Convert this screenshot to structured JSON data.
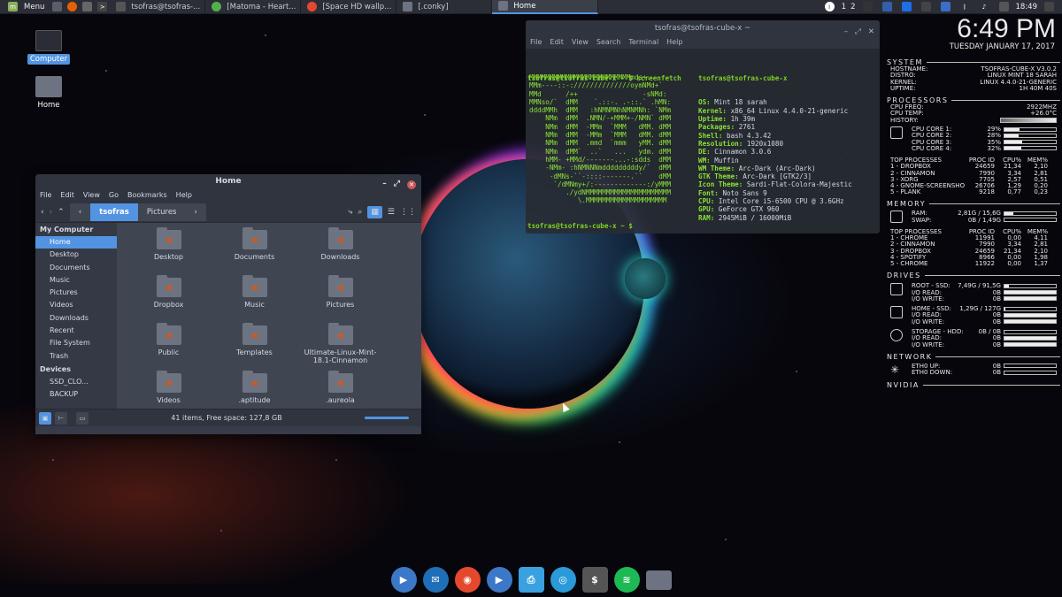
{
  "topbar": {
    "menu_label": "Menu",
    "tasks": [
      "tsofras@tsofras-...",
      "[Matoma - Heart...",
      "[Space HD wallp...",
      "[.conky]",
      "Home"
    ],
    "workspaces": [
      "1",
      "2"
    ],
    "clock": "18:49"
  },
  "desktop": {
    "icons": [
      "Computer",
      "Home"
    ]
  },
  "filemanager": {
    "title": "Home",
    "menu": [
      "File",
      "Edit",
      "View",
      "Go",
      "Bookmarks",
      "Help"
    ],
    "breadcrumb": [
      "tsofras",
      "Pictures"
    ],
    "sidebar": {
      "header_computer": "My Computer",
      "items": [
        "Home",
        "Desktop",
        "Documents",
        "Music",
        "Pictures",
        "Videos",
        "Downloads",
        "Recent",
        "File System",
        "Trash"
      ],
      "header_devices": "Devices",
      "devices": [
        "SSD_CLO...",
        "BACKUP"
      ]
    },
    "files": [
      "Desktop",
      "Documents",
      "Downloads",
      "Dropbox",
      "Music",
      "Pictures",
      "Public",
      "Templates",
      "Ultimate-Linux-Mint-18.1-Cinnamon",
      "Videos",
      ".aptitude",
      ".aureola"
    ],
    "status": "41 items, Free space: 127,8 GB"
  },
  "terminal": {
    "title": "tsofras@tsofras-cube-x ~",
    "menu": [
      "File",
      "Edit",
      "View",
      "Search",
      "Terminal",
      "Help"
    ],
    "prompt": "tsofras@tsofras-cube-x ~ $ screenfetch",
    "prompt2": "tsofras@tsofras-cube-x ~ $",
    "logo": [
      "MMMMMMMMMMMMMMMMMMMMMMMMMmds+.",
      "MMm----::-://////////////oymNMd+`",
      "MMd      /++                -sNMd:",
      "MMNso/`  dMM    `.::-. .-::.` .hMN:",
      "ddddMMh  dMM   :hNMNMNhNMNMNh: `NMm",
      "    NMm  dMM  .NMN/-+MMM+-/NMN` dMM",
      "    NMm  dMM  -MMm  `MMM   dMM. dMM",
      "    NMm  dMM  -MMm  `MMM   dMM. dMM",
      "    NMm  dMM  .mmd  `mmm   yMM. dMM",
      "    NMm  dMM`  ..`   ...   ydm. dMM",
      "    hMM- +MMd/-------...-:sdds  dMM",
      "    -NMm- :hNMNNNmdddddddddy/`  dMM",
      "     -dMNs-``-::::-------.``    dMM",
      "      `/dMNmy+/:-------------:/yMMM",
      "         ./ydNMMMMMMMMMMMMMMMMMMMMM",
      "            \\.MMMMMMMMMMMMMMMMMMMM"
    ],
    "user": "tsofras@tsofras-cube-x",
    "info": [
      [
        "OS:",
        "Mint 18 sarah"
      ],
      [
        "Kernel:",
        "x86_64 Linux 4.4.0-21-generic"
      ],
      [
        "Uptime:",
        "1h 39m"
      ],
      [
        "Packages:",
        "2761"
      ],
      [
        "Shell:",
        "bash 4.3.42"
      ],
      [
        "Resolution:",
        "1920x1080"
      ],
      [
        "DE:",
        "Cinnamon 3.0.6"
      ],
      [
        "WM:",
        "Muffin"
      ],
      [
        "WM Theme:",
        "Arc-Dark (Arc-Dark)"
      ],
      [
        "GTK Theme:",
        "Arc-Dark [GTK2/3]"
      ],
      [
        "Icon Theme:",
        "Sardi-Flat-Colora-Majestic"
      ],
      [
        "Font:",
        "Noto Sans 9"
      ],
      [
        "CPU:",
        "Intel Core i5-6500 CPU @ 3.6GHz"
      ],
      [
        "GPU:",
        "GeForce GTX 960"
      ],
      [
        "RAM:",
        "2945MiB / 16000MiB"
      ]
    ]
  },
  "conky": {
    "time": "6:49 PM",
    "date": "TUESDAY JANUARY 17, 2017",
    "system": {
      "label": "SYSTEM",
      "rows": [
        [
          "HOSTNAME:",
          "TSOFRAS-CUBE-X  V3.0.2"
        ],
        [
          "DISTRO:",
          "LINUX MINT 18 SARAH"
        ],
        [
          "KERNEL:",
          "LINUX 4.4.0-21-GENERIC"
        ],
        [
          "UPTIME:",
          "1H 40M 40S"
        ]
      ]
    },
    "processors": {
      "label": "PROCESSORS",
      "freq": [
        "CPU FREQ:",
        "2922MHZ"
      ],
      "temp": [
        "CPU TEMP:",
        "+26.0°C"
      ],
      "history": "HISTORY:",
      "cores": [
        {
          "name": "CPU CORE 1:",
          "pct": "29%",
          "v": 0.29
        },
        {
          "name": "CPU CORE 2:",
          "pct": "28%",
          "v": 0.28
        },
        {
          "name": "CPU CORE 3:",
          "pct": "35%",
          "v": 0.35
        },
        {
          "name": "CPU CORE 4:",
          "pct": "32%",
          "v": 0.32
        }
      ],
      "top_header": [
        "TOP PROCESSES",
        "PROC ID",
        "CPU%",
        "MEM%"
      ],
      "top": [
        [
          "1 - DROPBOX",
          "24659",
          "21,34",
          "2,10"
        ],
        [
          "2 - CINNAMON",
          "7990",
          "3,34",
          "2,81"
        ],
        [
          "3 - XORG",
          "7705",
          "2,57",
          "0,51"
        ],
        [
          "4 - GNOME-SCREENSHO",
          "26706",
          "1,29",
          "0,20"
        ],
        [
          "5 - PLANK",
          "9218",
          "0,77",
          "0,23"
        ]
      ]
    },
    "memory": {
      "label": "MEMORY",
      "ram": [
        "RAM:",
        "2,81G / 15,6G"
      ],
      "ram_v": 0.18,
      "swap": [
        "SWAP:",
        "0B / 1,49G"
      ],
      "swap_v": 0,
      "top_header": [
        "TOP PROCESSES",
        "PROC ID",
        "CPU%",
        "MEM%"
      ],
      "top": [
        [
          "1 - CHROME",
          "11991",
          "0,00",
          "4,11"
        ],
        [
          "2 - CINNAMON",
          "7990",
          "3,34",
          "2,81"
        ],
        [
          "3 - DROPBOX",
          "24659",
          "21,34",
          "2,10"
        ],
        [
          "4 - SPOTIFY",
          "8966",
          "0,00",
          "1,98"
        ],
        [
          "5 - CHROME",
          "11922",
          "0,00",
          "1,37"
        ]
      ]
    },
    "drives": {
      "label": "DRIVES",
      "list": [
        {
          "name": "ROOT - SSD:",
          "size": "7,49G / 91,5G",
          "read": "0B",
          "write": "0B",
          "v": 0.08
        },
        {
          "name": "HOME - SSD:",
          "size": "1,29G / 127G",
          "read": "0B",
          "write": "0B",
          "v": 0.01
        },
        {
          "name": "STORAGE - HDD:",
          "size": "0B / 0B",
          "read": "0B",
          "write": "0B",
          "v": 0
        }
      ],
      "read_label": "I/O READ:",
      "write_label": "I/O WRITE:"
    },
    "network": {
      "label": "NETWORK",
      "up": [
        "ETH0 UP:",
        "0B"
      ],
      "down": [
        "ETH0 DOWN:",
        "0B"
      ]
    },
    "nvidia": {
      "label": "NVIDIA"
    }
  },
  "dock": [
    "video-player",
    "thunderbird",
    "chrome",
    "video-player-2",
    "printer",
    "eye-app",
    "terminal",
    "spotify",
    "files"
  ]
}
